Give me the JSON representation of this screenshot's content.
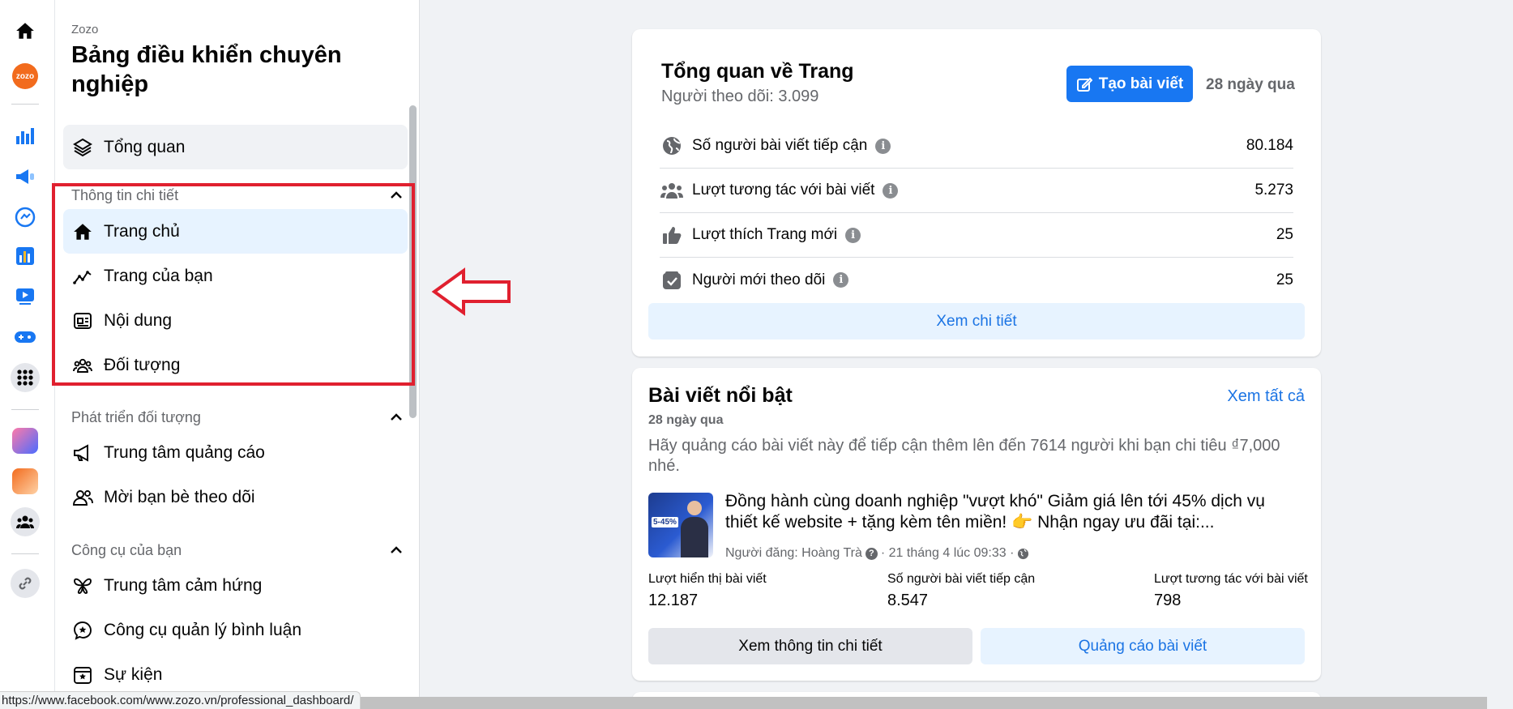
{
  "sidebar": {
    "brand": "Zozo",
    "title": "Bảng điều khiển chuyên nghiệp",
    "overview_label": "Tổng quan",
    "sections": [
      {
        "title": "Thông tin chi tiết",
        "items": [
          {
            "label": "Trang chủ",
            "icon": "home-icon",
            "active": true
          },
          {
            "label": "Trang của bạn",
            "icon": "trend-icon"
          },
          {
            "label": "Nội dung",
            "icon": "content-icon"
          },
          {
            "label": "Đối tượng",
            "icon": "audience-icon"
          }
        ]
      },
      {
        "title": "Phát triển đối tượng",
        "items": [
          {
            "label": "Trung tâm quảng cáo",
            "icon": "megaphone-icon"
          },
          {
            "label": "Mời bạn bè theo dõi",
            "icon": "invite-friends-icon"
          }
        ]
      },
      {
        "title": "Công cụ của bạn",
        "items": [
          {
            "label": "Trung tâm cảm hứng",
            "icon": "butterfly-icon"
          },
          {
            "label": "Công cụ quản lý bình luận",
            "icon": "comment-star-icon"
          },
          {
            "label": "Sự kiện",
            "icon": "calendar-star-icon"
          }
        ]
      }
    ]
  },
  "rail": {
    "icons": [
      "home-icon",
      "zozo-avatar",
      "insights-bar-icon",
      "ads-megaphone-icon",
      "messenger-icon",
      "reports-icon",
      "video-icon",
      "gaming-icon",
      "all-tools-grid-icon",
      "app-avatar-1",
      "app-avatar-2",
      "groups-icon",
      "link-icon"
    ],
    "brand_badge": "zozo"
  },
  "overview": {
    "title": "Tổng quan về Trang",
    "followers": "Người theo dõi: 3.099",
    "create_post_label": "Tạo bài viết",
    "period": "28 ngày qua",
    "metrics": [
      {
        "label": "Số người bài viết tiếp cận",
        "value": "80.184",
        "icon": "globe-icon"
      },
      {
        "label": "Lượt tương tác với bài viết",
        "value": "5.273",
        "icon": "people-icon"
      },
      {
        "label": "Lượt thích Trang mới",
        "value": "25",
        "icon": "thumbs-up-icon"
      },
      {
        "label": "Người mới theo dõi",
        "value": "25",
        "icon": "follow-check-icon"
      }
    ],
    "detail_label": "Xem chi tiết"
  },
  "featured": {
    "title": "Bài viết nổi bật",
    "see_all": "Xem tất cả",
    "period": "28 ngày qua",
    "promo": "Hãy quảng cáo bài viết này để tiếp cận thêm lên đến 7614 người khi bạn chi tiêu ₫7,000 nhé.",
    "post_text": "Đồng hành cùng doanh nghiệp \"vượt khó\" Giảm giá lên tới 45% dịch vụ thiết kế website + tặng kèm tên miền! 👉 Nhận ngay ưu đãi tại:...",
    "thumb_tag": "5-45%",
    "post_author": "Người đăng: Hoàng Trà",
    "post_time": "· 21 tháng 4 lúc 09:33 ·",
    "stats": [
      {
        "label": "Lượt hiển thị bài viết",
        "value": "12.187"
      },
      {
        "label": "Số người bài viết tiếp cận",
        "value": "8.547"
      },
      {
        "label": "Lượt tương tác với bài viết",
        "value": "798"
      }
    ],
    "view_details_label": "Xem thông tin chi tiết",
    "promote_label": "Quảng cáo bài viết"
  },
  "status_bar": {
    "url": "https://www.facebook.com/www.zozo.vn/professional_dashboard/"
  },
  "colors": {
    "accent": "#1877f2",
    "link": "#1b74e4",
    "highlight_red": "#e0202f",
    "active_bg": "#e7f3ff"
  }
}
